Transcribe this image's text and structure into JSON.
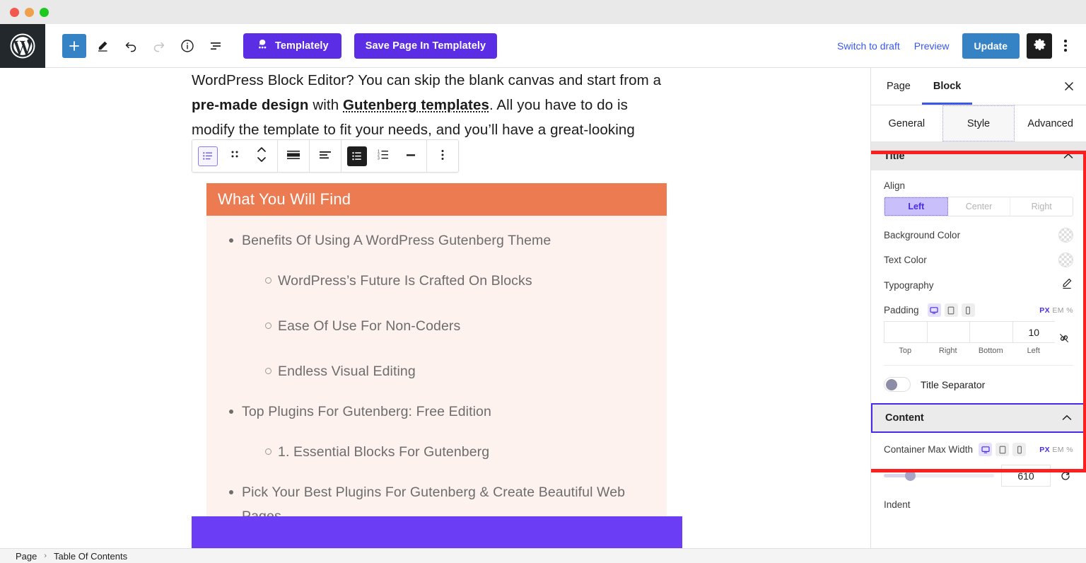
{
  "window": {
    "traffic_lights": [
      "close",
      "minimize",
      "maximize"
    ]
  },
  "topbar": {
    "logo": "wordpress-logo",
    "tools": [
      {
        "name": "add-block",
        "icon": "plus-icon",
        "label": "+"
      },
      {
        "name": "edit-tool",
        "icon": "pencil-icon",
        "label": ""
      },
      {
        "name": "undo",
        "icon": "undo-arrow-icon",
        "label": ""
      },
      {
        "name": "redo",
        "icon": "redo-arrow-icon",
        "label": ""
      },
      {
        "name": "details",
        "icon": "info-circle-icon",
        "label": ""
      },
      {
        "name": "list-view",
        "icon": "list-view-icon",
        "label": ""
      }
    ],
    "templately_label": "Templately",
    "save_templately_label": "Save Page In Templately",
    "switch_to_draft_label": "Switch to draft",
    "preview_label": "Preview",
    "update_label": "Update",
    "settings_icon": "gear-icon",
    "options_icon": "kebab-menu-icon"
  },
  "editor": {
    "paragraph": {
      "line1_pre": "WordPress Block Editor? You can skip the blank canvas and start from a ",
      "line1_bold": "pre-made design",
      "line2_mid": " with ",
      "line2_link": "Gutenberg templates",
      "line2_post": ". All you have to do is modify the template to fit your needs, and you’ll have a great-looking design with no work."
    },
    "block_toolbar": [
      {
        "name": "block-type-toc-icon",
        "icon": "toc-block-icon",
        "state": "selected"
      },
      {
        "name": "drag-handle-icon",
        "icon": "six-dot-drag-icon"
      },
      {
        "name": "move-up-down-icon",
        "icon": "chevron-up-down-icon"
      },
      {
        "name": "align-full-icon",
        "icon": "align-full-width-icon"
      },
      {
        "name": "text-align-icon",
        "icon": "text-align-left-icon"
      },
      {
        "name": "bullet-list-icon",
        "icon": "unordered-list-icon",
        "state": "active"
      },
      {
        "name": "numbered-list-icon",
        "icon": "ordered-list-icon"
      },
      {
        "name": "dash-list-icon",
        "icon": "dash-icon"
      },
      {
        "name": "more-options-icon",
        "icon": "vertical-kebab-icon"
      }
    ]
  },
  "toc": {
    "title": "What You Will Find",
    "items": [
      {
        "level": 1,
        "text": "Benefits Of Using A WordPress Gutenberg Theme"
      },
      {
        "level": 2,
        "text": "WordPress’s Future Is Crafted On Blocks"
      },
      {
        "level": 2,
        "text": "Ease Of Use For Non-Coders"
      },
      {
        "level": 2,
        "text": "Endless Visual Editing"
      },
      {
        "level": 1,
        "text": "Top Plugins For Gutenberg: Free Edition"
      },
      {
        "level": 2,
        "text": "1. Essential Blocks For Gutenberg"
      },
      {
        "level": 1,
        "text": "Pick Your Best Plugins For Gutenberg & Create Beautiful Web Pages"
      }
    ],
    "title_bg_color": "#ec7b51",
    "body_bg_color": "#fdf2ee",
    "purple_block_color": "#6b3ef5"
  },
  "sidebar": {
    "tabs": [
      {
        "label": "Page",
        "active": false
      },
      {
        "label": "Block",
        "active": true
      }
    ],
    "close_icon": "close-icon",
    "inspector_tabs": [
      {
        "label": "General",
        "active": false
      },
      {
        "label": "Style",
        "active": true
      },
      {
        "label": "Advanced",
        "active": false
      }
    ],
    "title_section": {
      "heading": "Title",
      "collapse_icon": "chevron-up-icon",
      "align_label": "Align",
      "align_options": [
        {
          "label": "Left",
          "active": true
        },
        {
          "label": "Center",
          "active": false
        },
        {
          "label": "Right",
          "active": false
        }
      ],
      "background_color_label": "Background Color",
      "text_color_label": "Text Color",
      "typography_label": "Typography",
      "typography_icon": "pencil-edit-icon",
      "padding_label": "Padding",
      "device_icons": [
        {
          "name": "desktop-icon",
          "active": true
        },
        {
          "name": "tablet-icon",
          "active": false
        },
        {
          "name": "mobile-icon",
          "active": false
        }
      ],
      "units": [
        {
          "label": "PX",
          "active": true
        },
        {
          "label": "EM",
          "active": false
        },
        {
          "label": "%",
          "active": false
        }
      ],
      "padding_fields": [
        {
          "caption": "Top",
          "value": ""
        },
        {
          "caption": "Right",
          "value": ""
        },
        {
          "caption": "Bottom",
          "value": ""
        },
        {
          "caption": "Left",
          "value": "10"
        }
      ],
      "link_values_icon": "unlink-icon",
      "title_separator_label": "Title Separator",
      "title_separator_on": false
    },
    "content_section": {
      "heading": "Content",
      "collapse_icon": "chevron-up-icon",
      "container_max_width_label": "Container Max Width",
      "device_icons": [
        {
          "name": "desktop-icon",
          "active": true
        },
        {
          "name": "tablet-icon",
          "active": false
        },
        {
          "name": "mobile-icon",
          "active": false
        }
      ],
      "units": [
        {
          "label": "PX",
          "active": true
        },
        {
          "label": "EM",
          "active": false
        },
        {
          "label": "%",
          "active": false
        }
      ],
      "container_max_width_value": "610",
      "reset_icon": "reset-circular-arrow-icon",
      "indent_label": "Indent"
    },
    "highlight_color": "#fb1f1f",
    "content_highlight_color": "#4a2ae8"
  },
  "statusbar": {
    "breadcrumb": [
      "Page",
      "Table Of Contents"
    ],
    "separator": "›"
  }
}
